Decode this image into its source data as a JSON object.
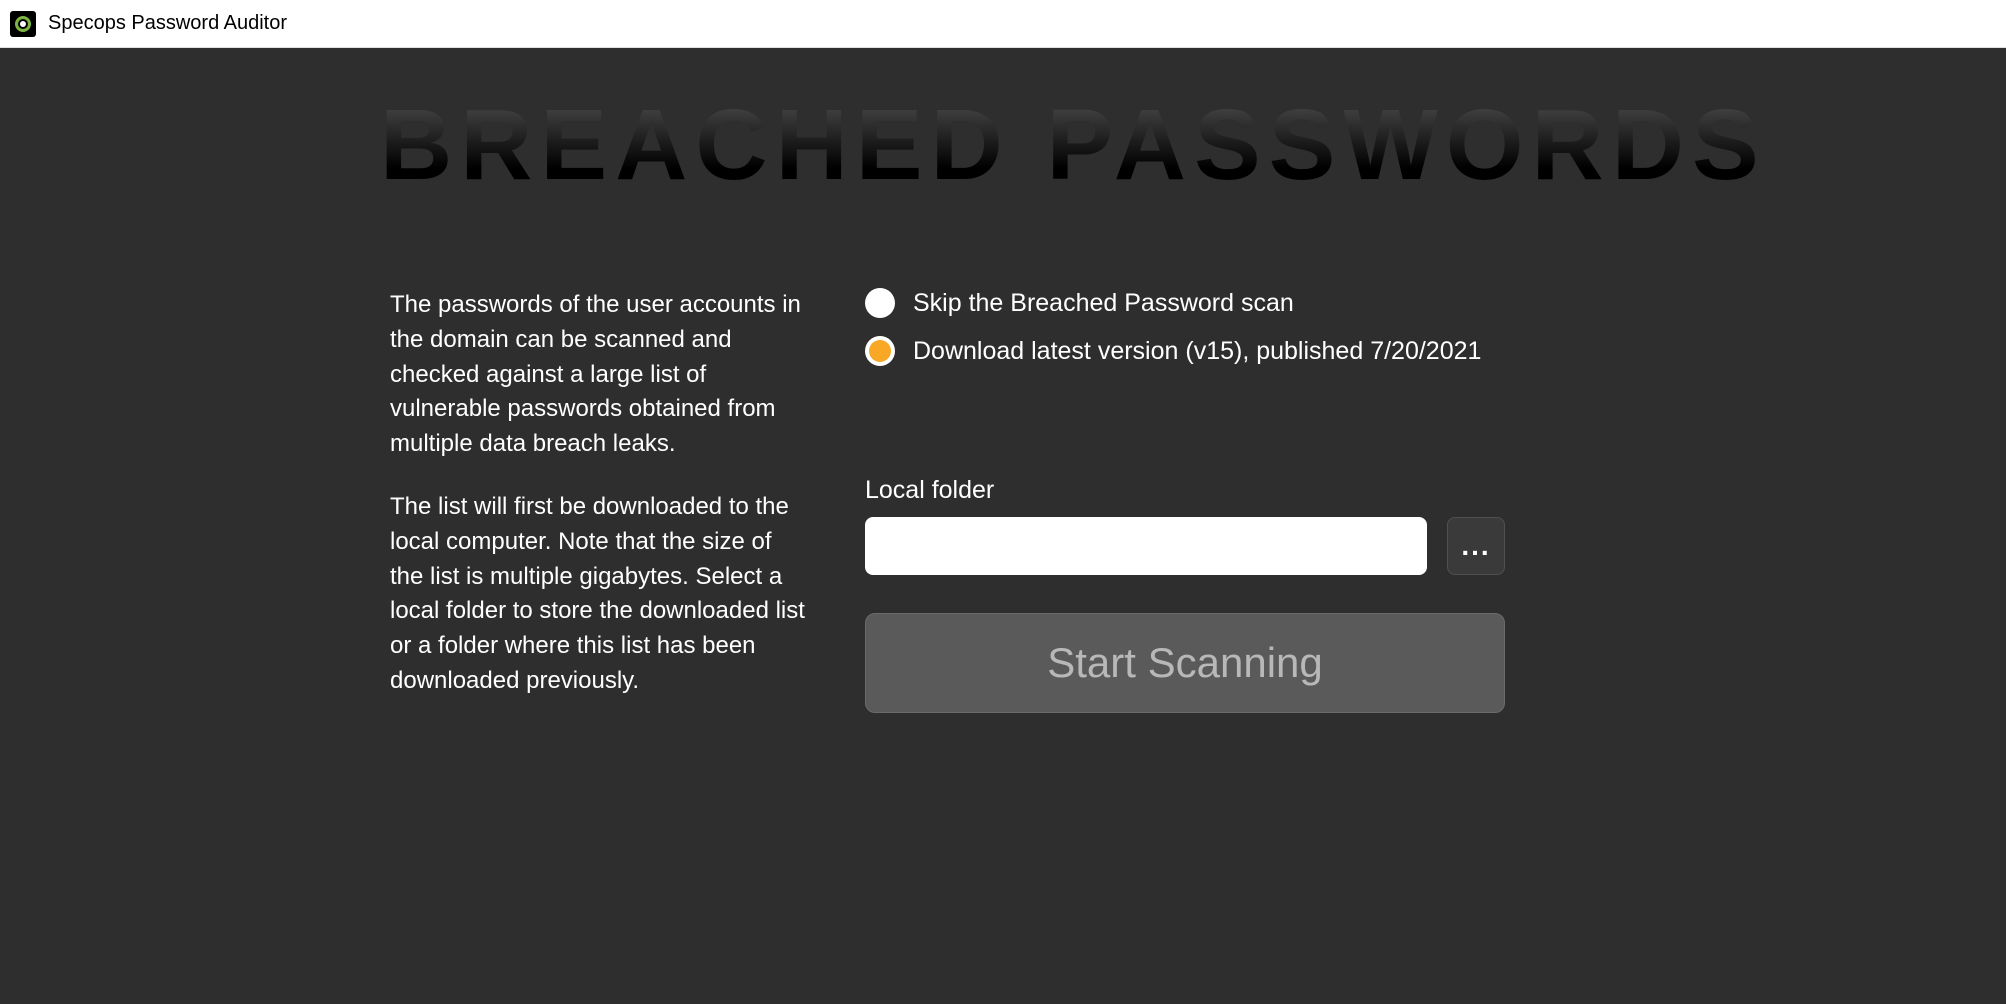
{
  "window": {
    "title": "Specops Password Auditor"
  },
  "heading": "BREACHED PASSWORDS",
  "description": {
    "paragraph1": "The passwords of the user accounts in the domain can be scanned and checked against a large list of vulnerable passwords obtained from multiple data breach leaks.",
    "paragraph2": "The list will first be downloaded to the local computer. Note that the size of the list is multiple gigabytes. Select a local folder to store the downloaded list or a folder where this list has been downloaded previously."
  },
  "options": {
    "skip": {
      "label": "Skip the Breached Password scan",
      "selected": false
    },
    "download": {
      "label": "Download latest version (v15), published 7/20/2021",
      "selected": true
    }
  },
  "folder": {
    "label": "Local folder",
    "value": "",
    "browse_label": "..."
  },
  "start_button": {
    "label": "Start Scanning"
  }
}
